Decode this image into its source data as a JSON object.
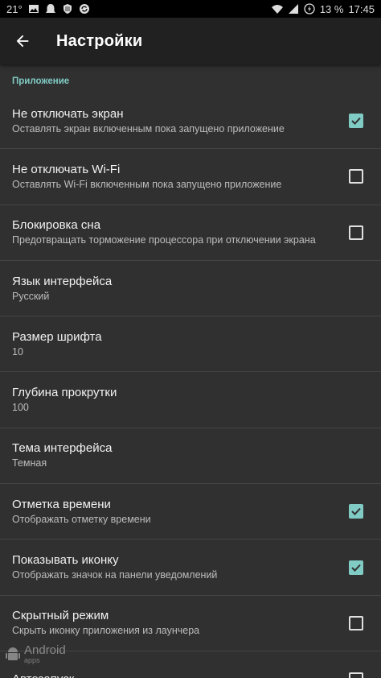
{
  "status_bar": {
    "temperature": "21°",
    "battery": "13 %",
    "time": "17:45",
    "icons_left": [
      "image-icon",
      "ghost-icon",
      "shield-icon",
      "sync-icon"
    ],
    "icons_right": [
      "wifi-icon",
      "signal-icon",
      "battery-icon"
    ]
  },
  "toolbar": {
    "title": "Настройки",
    "back_icon": "arrow-back-icon"
  },
  "category": {
    "label": "Приложение"
  },
  "accent_color": "#80cbc4",
  "preferences": [
    {
      "title": "Не отключать экран",
      "summary": "Оставлять экран включенным пока запущено приложение",
      "checked": true
    },
    {
      "title": "Не отключать Wi-Fi",
      "summary": "Оставлять Wi-Fi включенным пока запущено приложение",
      "checked": false
    },
    {
      "title": "Блокировка сна",
      "summary": "Предотвращать торможение процессора при отключении экрана",
      "checked": false
    },
    {
      "title": "Язык интерфейса",
      "summary": "Русский"
    },
    {
      "title": "Размер шрифта",
      "summary": "10"
    },
    {
      "title": "Глубина прокрутки",
      "summary": "100"
    },
    {
      "title": "Тема интерфейса",
      "summary": "Темная"
    },
    {
      "title": "Отметка времени",
      "summary": "Отображать отметку времени",
      "checked": true
    },
    {
      "title": "Показывать иконку",
      "summary": "Отображать значок на панели уведомлений",
      "checked": true
    },
    {
      "title": "Скрытный режим",
      "summary": "Скрыть иконку приложения из лаунчера",
      "checked": false
    },
    {
      "title": "Автозапуск",
      "summary": "",
      "checked": false
    }
  ],
  "watermark": {
    "text": "Android",
    "sub": "apps"
  }
}
